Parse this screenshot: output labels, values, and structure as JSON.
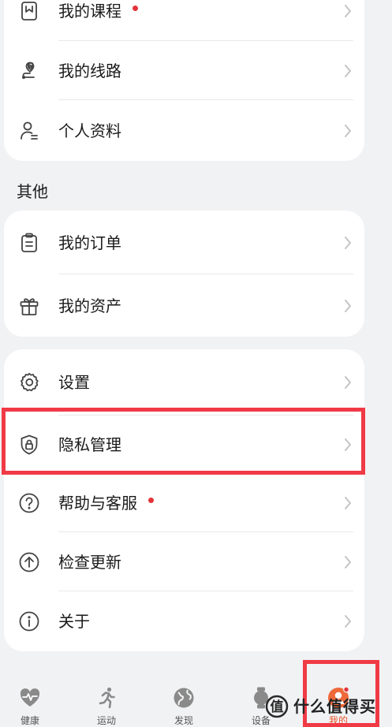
{
  "colors": {
    "background": "#f1f2f4",
    "card": "#ffffff",
    "text": "#1a1a1a",
    "icon": "#444444",
    "chevron": "#c4c4c4",
    "badge_dot": "#e5343a",
    "highlight": "#f03a45",
    "tab_active": "#e8552b"
  },
  "card1": {
    "items": [
      {
        "label": "我的课程",
        "icon": "book-icon",
        "badge": true
      },
      {
        "label": "我的线路",
        "icon": "route-icon",
        "badge": false
      },
      {
        "label": "个人资料",
        "icon": "profile-icon",
        "badge": false
      }
    ]
  },
  "section_other": {
    "title": "其他"
  },
  "card2": {
    "items": [
      {
        "label": "我的订单",
        "icon": "order-clipboard-icon",
        "badge": false
      },
      {
        "label": "我的资产",
        "icon": "gift-icon",
        "badge": false
      }
    ]
  },
  "card3": {
    "items": [
      {
        "label": "设置",
        "icon": "gear-icon",
        "badge": false
      },
      {
        "label": "隐私管理",
        "icon": "shield-lock-icon",
        "badge": false
      },
      {
        "label": "帮助与客服",
        "icon": "help-icon",
        "badge": true
      },
      {
        "label": "检查更新",
        "icon": "update-arrow-icon",
        "badge": false
      },
      {
        "label": "关于",
        "icon": "info-icon",
        "badge": false
      }
    ]
  },
  "tabbar": {
    "tabs": [
      {
        "label": "健康",
        "icon": "heart-pulse-icon",
        "active": false
      },
      {
        "label": "运动",
        "icon": "runner-icon",
        "active": false
      },
      {
        "label": "发现",
        "icon": "globe-icon",
        "active": false
      },
      {
        "label": "设备",
        "icon": "watch-icon",
        "active": false
      },
      {
        "label": "我的",
        "icon": "me-avatar-icon",
        "active": true
      }
    ]
  },
  "watermark": {
    "text": "什么值得买",
    "icon": "smzdm-logo-icon"
  }
}
